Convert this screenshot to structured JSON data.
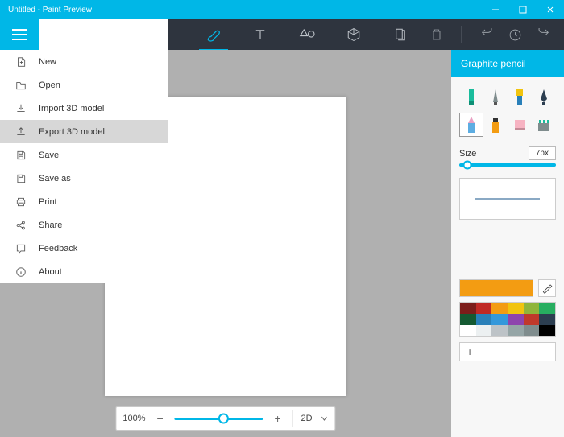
{
  "title": "Untitled - Paint Preview",
  "toolbar": {
    "tabs": [
      "brush",
      "text",
      "shapes",
      "3d",
      "canvas"
    ],
    "active": 0
  },
  "menu": {
    "items": [
      {
        "label": "New"
      },
      {
        "label": "Open"
      },
      {
        "label": "Import 3D model"
      },
      {
        "label": "Export 3D model"
      },
      {
        "label": "Save"
      },
      {
        "label": "Save as"
      },
      {
        "label": "Print"
      },
      {
        "label": "Share"
      },
      {
        "label": "Feedback"
      },
      {
        "label": "About"
      }
    ],
    "hovered_index": 3
  },
  "zoom": {
    "percent": "100%",
    "mode": "2D"
  },
  "side": {
    "title": "Graphite pencil",
    "size_label": "Size",
    "size_value": "7px",
    "current_color": "#f39c12",
    "palette": [
      "#7c1d1a",
      "#c02925",
      "#f39c12",
      "#f1c40f",
      "#8fb53b",
      "#27ae60",
      "#145a32",
      "#2980b9",
      "#3498db",
      "#8e44ad",
      "#c0392b",
      "#2c3e50",
      "#ffffff",
      "#ecf0f1",
      "#bdc3c7",
      "#95a5a6",
      "#7f8c8d",
      "#000000"
    ],
    "add_label": "+"
  }
}
